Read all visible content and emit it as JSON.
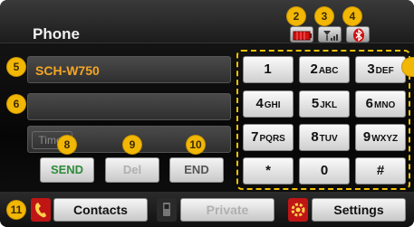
{
  "header": {
    "title": "Phone",
    "icons": [
      "battery-icon",
      "signal-icon",
      "bluetooth-icon"
    ]
  },
  "callouts": [
    "2",
    "3",
    "4",
    "5",
    "6",
    "8",
    "9",
    "10",
    "11"
  ],
  "display": {
    "number": "SCH-W750",
    "input_value": "",
    "timer_label": "Timer"
  },
  "actions": {
    "send": "SEND",
    "del": "Del",
    "end": "END"
  },
  "keypad": [
    {
      "num": "1",
      "letters": ""
    },
    {
      "num": "2",
      "letters": "ABC"
    },
    {
      "num": "3",
      "letters": "DEF"
    },
    {
      "num": "4",
      "letters": "GHI"
    },
    {
      "num": "5",
      "letters": "JKL"
    },
    {
      "num": "6",
      "letters": "MNO"
    },
    {
      "num": "7",
      "letters": "PQRS"
    },
    {
      "num": "8",
      "letters": "TUV"
    },
    {
      "num": "9",
      "letters": "WXYZ"
    },
    {
      "num": "*",
      "letters": ""
    },
    {
      "num": "0",
      "letters": ""
    },
    {
      "num": "#",
      "letters": ""
    }
  ],
  "bottom_bar": {
    "contacts": "Contacts",
    "private": "Private",
    "settings": "Settings"
  },
  "colors": {
    "accent": "#f5a623",
    "callout": "#f2b705",
    "send": "#2e8b3a",
    "end": "#555555",
    "disabled": "#b0b0b0"
  }
}
